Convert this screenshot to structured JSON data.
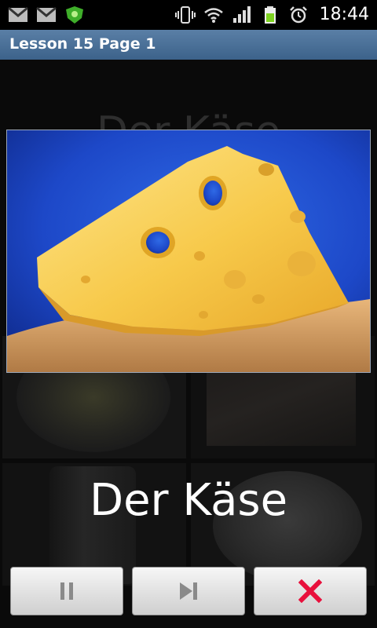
{
  "status_bar": {
    "time": "18:44",
    "icons": [
      "gmail-icon",
      "gmail-icon",
      "shield-app-icon",
      "vibrate-icon",
      "wifi-icon",
      "signal-icon",
      "battery-icon",
      "alarm-icon"
    ]
  },
  "header": {
    "title": "Lesson 15 Page 1"
  },
  "background": {
    "title": "Der Käse"
  },
  "card": {
    "caption": "Der Käse"
  },
  "controls": {
    "pause_icon": "pause-icon",
    "next_icon": "skip-next-icon",
    "close_icon": "close-icon",
    "close_color": "#e8103c"
  }
}
